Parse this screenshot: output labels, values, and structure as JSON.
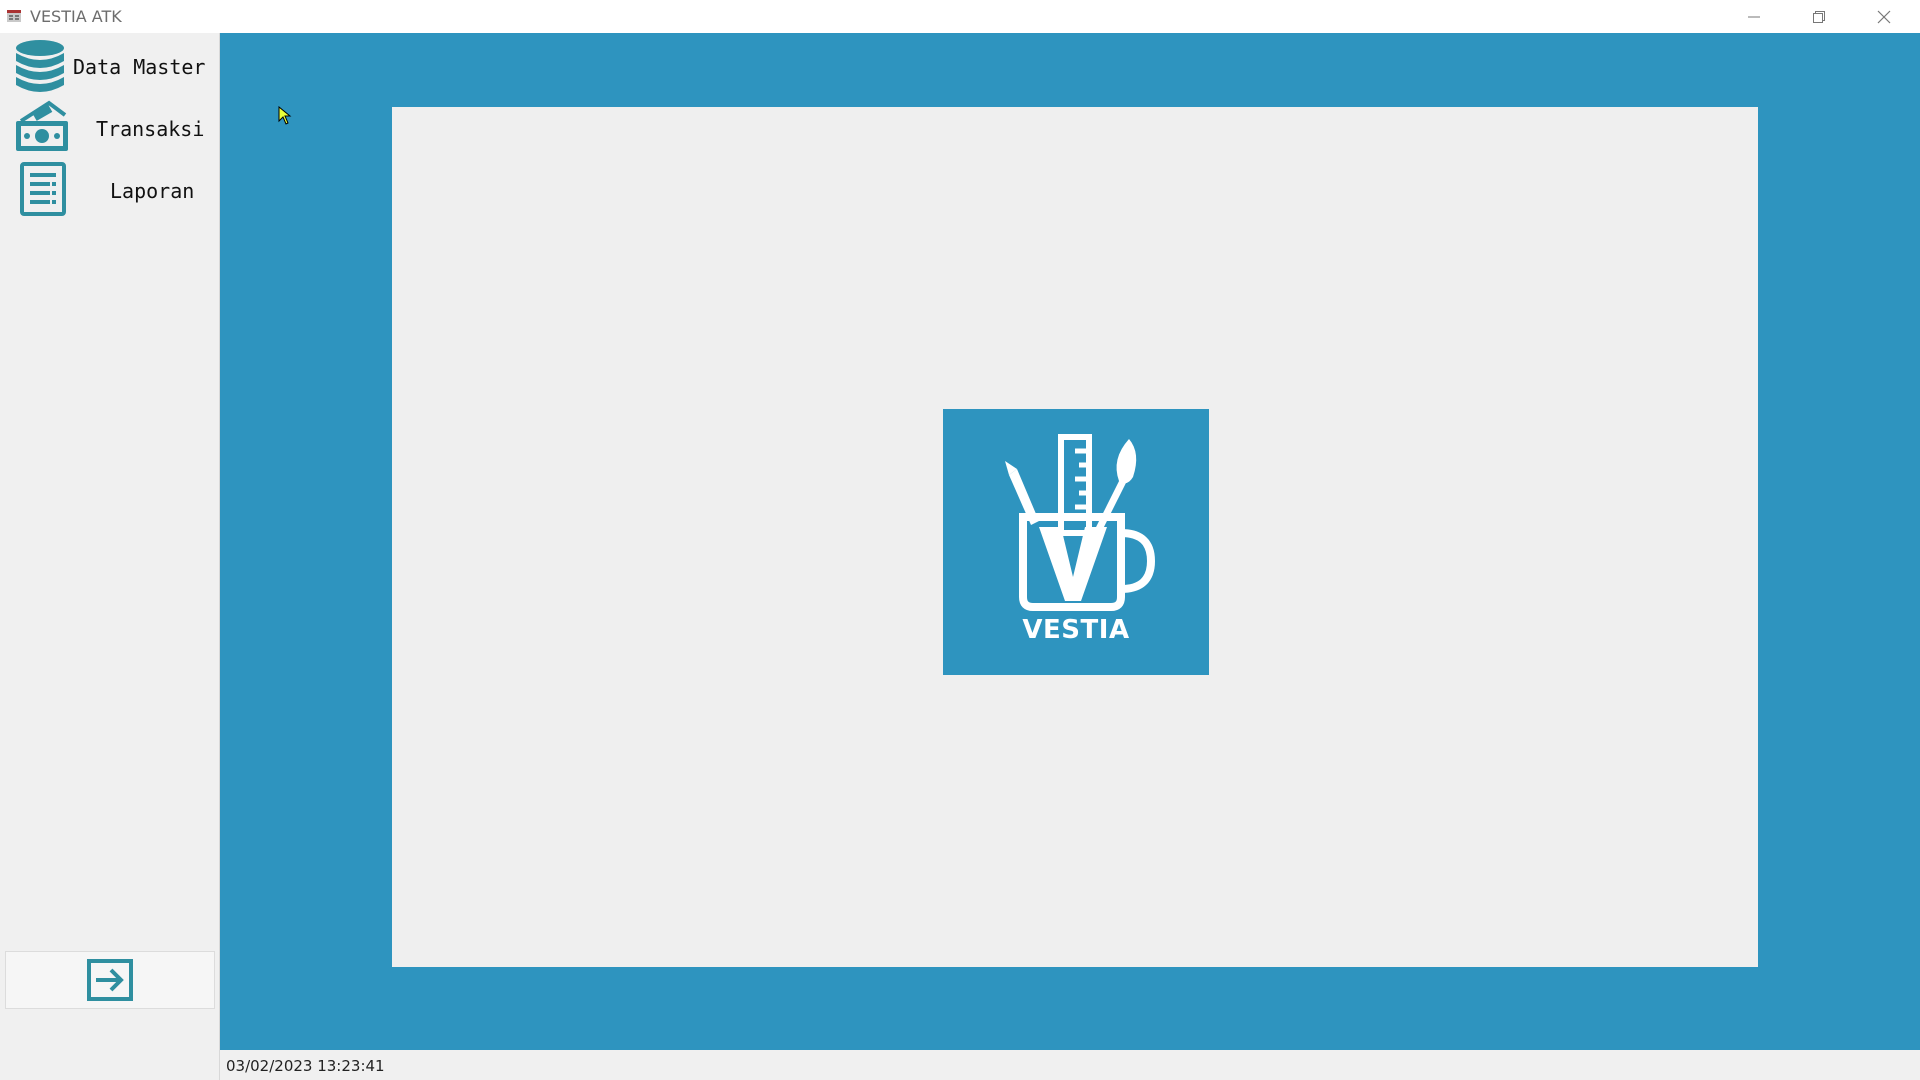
{
  "window": {
    "title": "VESTIA ATK",
    "controls": [
      "minimize",
      "restore",
      "close"
    ]
  },
  "sidebar": {
    "items": [
      {
        "label": "Data Master",
        "icon": "database-icon"
      },
      {
        "label": "Transaksi",
        "icon": "money-hand-icon"
      },
      {
        "label": "Laporan",
        "icon": "report-document-icon"
      }
    ],
    "logout_icon": "logout-arrow-icon"
  },
  "main": {
    "logo_text": "VESTIA",
    "logo_icon": "stationery-mug-icon"
  },
  "status": {
    "datetime": "03/02/2023 13:23:41"
  },
  "colors": {
    "accent": "#2e94bf",
    "panel": "#efefef",
    "sidebar": "#f0f0f0",
    "icon": "#2f8fa0"
  }
}
